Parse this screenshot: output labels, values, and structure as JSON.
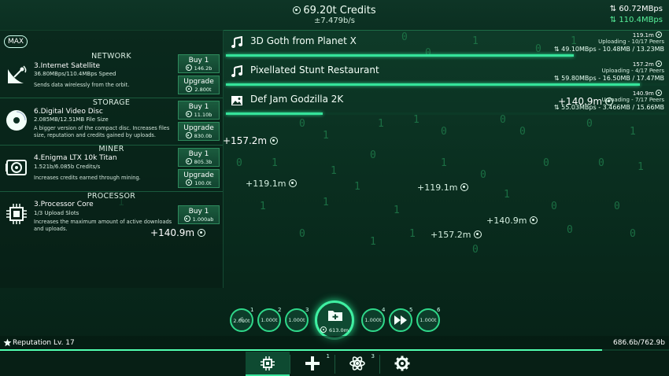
{
  "header": {
    "credits": "69.20t Credits",
    "rate": "±7.479b/s",
    "upload_speed": "60.72MBps",
    "download_speed": "110.4MBps"
  },
  "left_panel": {
    "max_label": "MAX",
    "sections": [
      {
        "title": "NETWORK",
        "item_name": "3.Internet Satellite",
        "stat": "36.80MBps/110.4MBps Speed",
        "desc": "Sends data wirelessly from the orbit.",
        "icon": "satellite-dish-icon",
        "buy_label": "Buy 1",
        "buy_cost": "146.2b",
        "upgrade_label": "Upgrade",
        "upgrade_cost": "2.800t"
      },
      {
        "title": "STORAGE",
        "item_name": "6.Digital Video Disc",
        "stat": "2.085MB/12.51MB File Size",
        "desc": "A bigger version of the compact disc. Increases files size, reputation and credits gained by uploads.",
        "icon": "disc-icon",
        "buy_label": "Buy 1",
        "buy_cost": "11.10b",
        "upgrade_label": "Upgrade",
        "upgrade_cost": "830.0b"
      },
      {
        "title": "MINER",
        "item_name": "4.Enigma LTX 10k Titan",
        "stat": "1.521b/6.085b Credits/s",
        "desc": "Increases credits earned through mining.",
        "icon": "gpu-icon",
        "buy_label": "Buy 1",
        "buy_cost": "805.3b",
        "upgrade_label": "Upgrade",
        "upgrade_cost": "100.0t"
      },
      {
        "title": "PROCESSOR",
        "item_name": "3.Processor Core",
        "stat": "1/3 Upload Slots",
        "desc": "Increases the maximum amount of active downloads and uploads.",
        "icon": "cpu-chip-icon",
        "buy_label": "Buy 1",
        "buy_cost": "1.000ab"
      }
    ]
  },
  "downloads": [
    {
      "title": "3D Goth from Planet X",
      "value": "119.1m",
      "status": "Uploading - 10/17 Peers",
      "speed": "49.10MBps - 10.48MB / 13.23MB",
      "progress": 0.79,
      "icon": "music-note-icon"
    },
    {
      "title": "Pixellated Stunt Restaurant",
      "value": "157.2m",
      "status": "Uploading - 4/17 Peers",
      "speed": "59.80MBps - 16.50MB / 17.47MB",
      "progress": 0.94,
      "icon": "music-note-icon"
    },
    {
      "title": "Def Jam Godzilla 2K",
      "value": "140.9m",
      "status": "Uploading - 7/17 Peers",
      "speed": "55.03MBps - 3.466MB / 15.66MB",
      "progress": 0.22,
      "icon": "image-icon"
    }
  ],
  "floating_values": [
    "+157.2m",
    "+119.1m",
    "+119.1m",
    "+140.9m",
    "+157.2m",
    "+140.9m",
    "+140.9m"
  ],
  "skills": [
    {
      "num": "1",
      "label": "2.000t",
      "icon": "mining-icon"
    },
    {
      "num": "2",
      "label": "1.000t",
      "icon": ""
    },
    {
      "num": "3",
      "label": "1.000t",
      "icon": ""
    },
    {
      "num": "4",
      "label": "1.000t",
      "icon": ""
    },
    {
      "num": "5",
      "label": "",
      "icon": "fast-forward-icon"
    },
    {
      "num": "6",
      "label": "1.000t",
      "icon": ""
    }
  ],
  "center_skill": {
    "cost": "613.0m",
    "icon": "add-folder-icon"
  },
  "reputation": {
    "label": "Reputation Lv. 17",
    "value": "686.6b/762.9b",
    "progress": 0.9
  },
  "nav": [
    {
      "icon": "hardware-gear-icon",
      "badge": ""
    },
    {
      "icon": "plus-icon",
      "badge": "1"
    },
    {
      "icon": "atom-icon",
      "badge": "3"
    },
    {
      "icon": "settings-icon",
      "badge": ""
    }
  ],
  "colors": {
    "accent": "#35e39a",
    "bg": "#0a2f20"
  }
}
